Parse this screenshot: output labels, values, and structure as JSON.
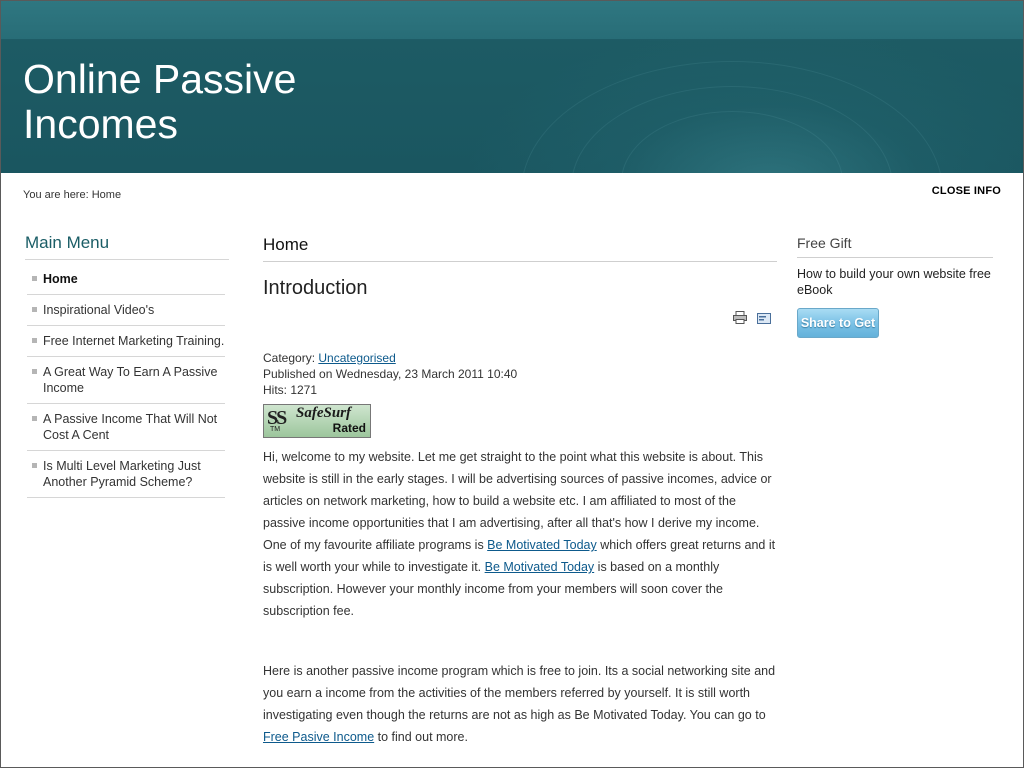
{
  "site": {
    "title": "Online Passive Incomes"
  },
  "breadcrumb": {
    "prefix": "You are here:",
    "current": "Home"
  },
  "close_info": "CLOSE INFO",
  "main_menu": {
    "title": "Main Menu",
    "items": [
      {
        "label": "Home",
        "active": true
      },
      {
        "label": "Inspirational Video's"
      },
      {
        "label": "Free Internet Marketing Training."
      },
      {
        "label": "A Great Way To Earn A Passive Income"
      },
      {
        "label": "A Passive Income That Will Not Cost A Cent"
      },
      {
        "label": "Is Multi Level Marketing Just Another Pyramid Scheme?"
      }
    ]
  },
  "main": {
    "page_heading": "Home",
    "article_title": "Introduction",
    "icons": {
      "print": "print-icon",
      "email": "email-icon"
    },
    "meta": {
      "category_label": "Category:",
      "category": "Uncategorised",
      "published": "Published on Wednesday, 23 March 2011 10:40",
      "hits": "Hits: 1271"
    },
    "badge": {
      "text": "SafeSurf",
      "sub": "Rated",
      "tm": "TM"
    },
    "paragraph1": {
      "part1": "Hi, welcome to my website. Let me get straight to the point what this website is about. This website is still in the early stages. I will be advertising sources of passive incomes, advice or articles on network marketing, how to build a website etc. I am affiliated to most of the passive income opportunities that I am advertising, after all that's how I derive my income. One of my favourite affiliate programs is ",
      "link1": "Be Motivated Today",
      "part2": " which offers great returns and it is well worth your while to investigate it. ",
      "link2": "Be Motivated Today",
      "part3": " is based on a monthly subscription. However your monthly income from your members will soon cover the subscription fee."
    },
    "paragraph2": {
      "part1": "Here is another passive income program which is free to join. Its a social networking site and you earn a income from the activities of the members referred  by yourself. It is still worth investigating even though the returns are not as high as Be Motivated Today.  You can go to",
      "link": " Free Pasive Income",
      "part2": " to find out more."
    }
  },
  "sidebar_right": {
    "title": "Free Gift",
    "text": "How to build your own website free eBook",
    "button": "Share to Get"
  },
  "colors": {
    "header": "#1d5b64",
    "accent": "#1a5d66",
    "link": "#0d5a8c",
    "button": "#7cc2e6"
  }
}
